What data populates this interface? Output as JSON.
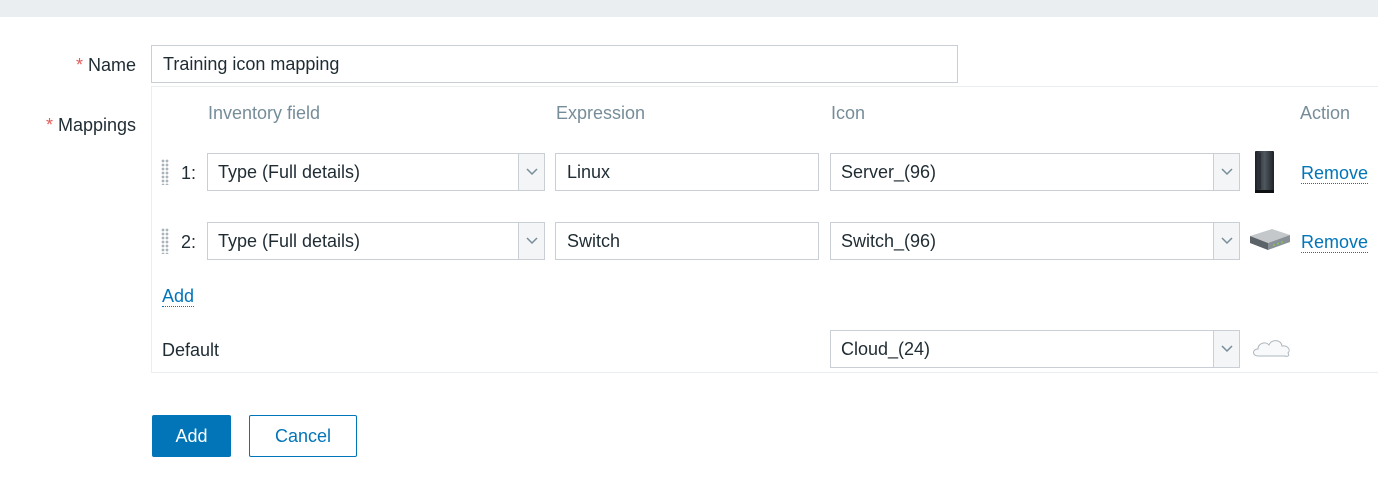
{
  "form": {
    "name_label": "Name",
    "name_value": "Training icon mapping",
    "mappings_label": "Mappings",
    "required_mark": "*"
  },
  "mappings": {
    "headers": {
      "inventory_field": "Inventory field",
      "expression": "Expression",
      "icon": "Icon",
      "action": "Action"
    },
    "rows": [
      {
        "num": "1:",
        "inventory_field": "Type (Full details)",
        "expression": "Linux",
        "icon": "Server_(96)",
        "icon_name": "server-icon",
        "action": "Remove"
      },
      {
        "num": "2:",
        "inventory_field": "Type (Full details)",
        "expression": "Switch",
        "icon": "Switch_(96)",
        "icon_name": "switch-icon",
        "action": "Remove"
      }
    ],
    "add_label": "Add",
    "default_label": "Default",
    "default_icon": "Cloud_(24)",
    "default_icon_name": "cloud-icon"
  },
  "buttons": {
    "add": "Add",
    "cancel": "Cancel"
  },
  "colors": {
    "link": "#0275b8",
    "required": "#e45959",
    "header_text": "#768d99",
    "primary_button": "#0275b8"
  }
}
